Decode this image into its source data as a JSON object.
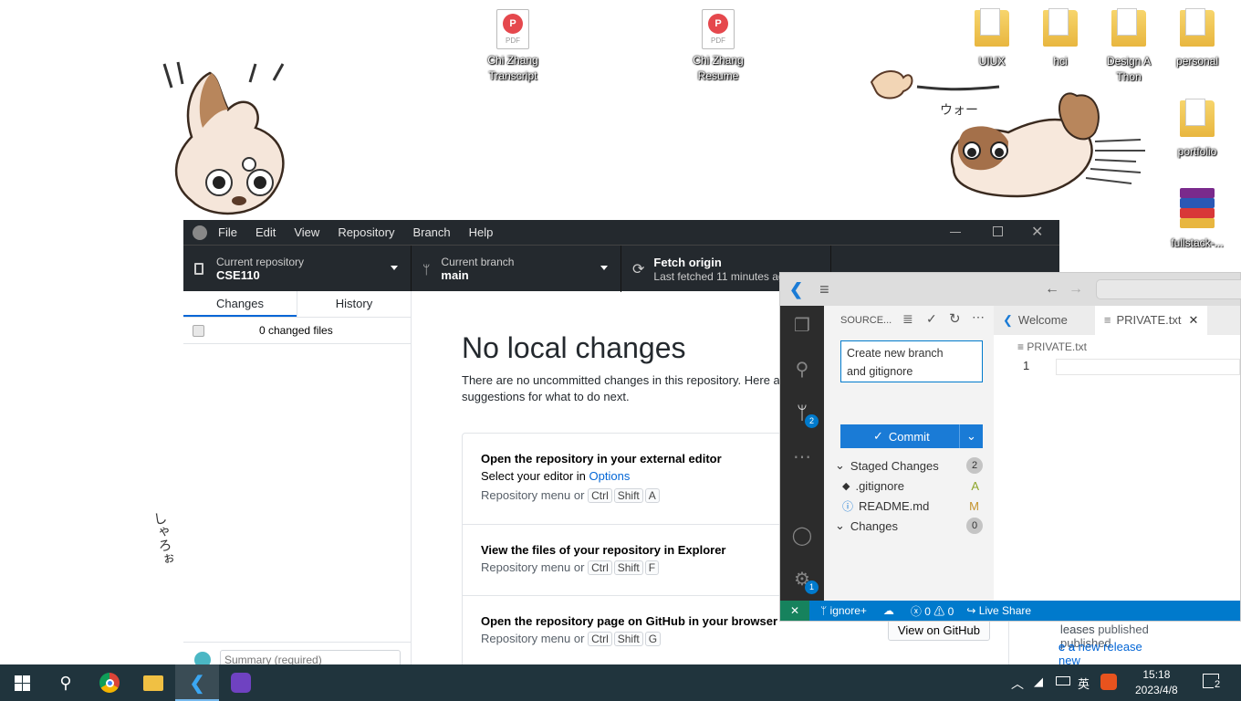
{
  "desktop": {
    "icons": [
      {
        "label_l1": "Chi Zhang",
        "label_l2": "Transcript",
        "kind": "pdf"
      },
      {
        "label_l1": "Chi Zhang",
        "label_l2": "Resume",
        "kind": "pdf"
      },
      {
        "label_l1": "UIUX",
        "kind": "folder"
      },
      {
        "label_l1": "hci",
        "kind": "folder"
      },
      {
        "label_l1": "Design A",
        "label_l2": "Thon",
        "kind": "folder"
      },
      {
        "label_l1": "personal",
        "kind": "folder"
      },
      {
        "label_l1": "portfolio",
        "kind": "folder"
      },
      {
        "label_l1": "fullstack-...",
        "kind": "winrar"
      }
    ],
    "pdf_badge": "P",
    "pdf_text": "PDF",
    "wallpaper_text": "ウォー",
    "wallpaper_text2": "しゃろぉ"
  },
  "github_desktop": {
    "menu": [
      "File",
      "Edit",
      "View",
      "Repository",
      "Branch",
      "Help"
    ],
    "repo": {
      "label": "Current repository",
      "value": "CSE110"
    },
    "branch": {
      "label": "Current branch",
      "value": "main"
    },
    "fetch": {
      "label": "Fetch origin",
      "sub": "Last fetched 11 minutes ag"
    },
    "tabs": {
      "changes": "Changes",
      "history": "History"
    },
    "changed_files": "0 changed files",
    "summary_placeholder": "Summary (required)",
    "main": {
      "title": "No local changes",
      "desc_l1": "There are no uncommitted changes in this repository. Here a",
      "desc_l2": "suggestions for what to do next.",
      "card1": {
        "title": "Open the repository in your external editor",
        "sub_prefix": "Select your editor in ",
        "sub_link": "Options",
        "hint": "Repository menu or",
        "keys": [
          "Ctrl",
          "Shift",
          "A"
        ]
      },
      "card2": {
        "title": "View the files of your repository in Explorer",
        "hint": "Repository menu or",
        "keys": [
          "Ctrl",
          "Shift",
          "F"
        ]
      },
      "card3": {
        "title": "Open the repository page on GitHub in your browser",
        "hint": "Repository menu or",
        "keys": [
          "Ctrl",
          "Shift",
          "G"
        ],
        "button": "View on GitHub"
      },
      "behind_text1": "leases published",
      "behind_text2": "e a new release"
    }
  },
  "vscode": {
    "sidebar_title": "SOURCE...",
    "commit_message_l1": "Create new branch",
    "commit_message_l2": "and gitignore",
    "commit_label": "Commit",
    "staged": {
      "label": "Staged Changes",
      "count": "2"
    },
    "files": [
      {
        "name": ".gitignore",
        "status": "A",
        "status_color": "#587c0c"
      },
      {
        "name": "README.md",
        "status": "M",
        "status_color": "#895503"
      }
    ],
    "changes": {
      "label": "Changes",
      "count": "0"
    },
    "scm_badge": "2",
    "settings_badge": "1",
    "tabs": [
      "Welcome",
      "PRIVATE.txt"
    ],
    "breadcrumb": "PRIVATE.txt",
    "line_number": "1",
    "status": {
      "branch": "ignore+",
      "errors": "0",
      "warnings": "0",
      "liveshare": "Live Share"
    }
  },
  "taskbar": {
    "time": "15:18",
    "date": "2023/4/8",
    "ime": "英",
    "notif_count": "2"
  },
  "colors": {
    "github_dark": "#24292e",
    "vscode_blue": "#007acc",
    "accent": "#0366d6"
  }
}
